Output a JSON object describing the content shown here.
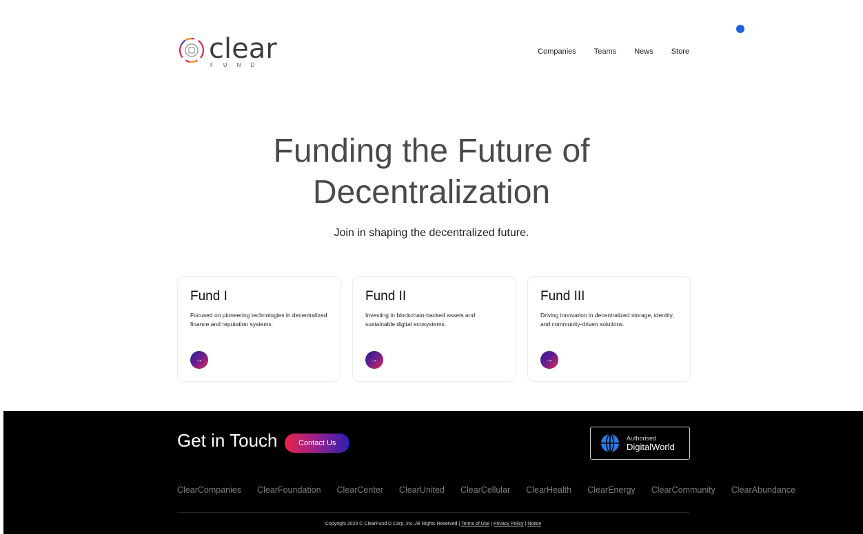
{
  "header": {
    "logo_word": "clear",
    "logo_sub": "FUND",
    "nav": [
      "Companies",
      "Teams",
      "News",
      "Store"
    ]
  },
  "hero": {
    "title_line1": "Funding the Future of",
    "title_line2": "Decentralization",
    "subtitle": "Join in shaping the decentralized future."
  },
  "cards": [
    {
      "title": "Fund I",
      "desc": "Focused on pioneering technologies in decentralized finance and reputation systems."
    },
    {
      "title": "Fund II",
      "desc": "Investing in blockchain-backed assets and sustainable digital ecosystems."
    },
    {
      "title": "Fund III",
      "desc": "Driving innovation in decentralized storage, identity, and community-driven solutions."
    }
  ],
  "footer": {
    "get_in_touch": "Get in Touch",
    "contact_label": "Contact Us",
    "badge_small": "Authorised",
    "badge_big": "DigitalWorld",
    "companies": [
      "ClearCompanies",
      "ClearFoundation",
      "ClearCenter",
      "ClearUnited",
      "ClearCellular",
      "ClearHealth",
      "ClearEnergy",
      "ClearCommunity",
      "ClearAbundance"
    ],
    "copyright_text": "Copyright 2025 © ClearFund D Corp, Inc. All Rights Reserved |",
    "terms": "Terms of Use",
    "privacy": "Privacy Policy",
    "notice": "Notice"
  },
  "colors": {
    "accent_dot": "#1f5fe6",
    "footer_bg": "#000000",
    "gradient_start": "#e8244a",
    "gradient_end": "#2b1fb0"
  }
}
